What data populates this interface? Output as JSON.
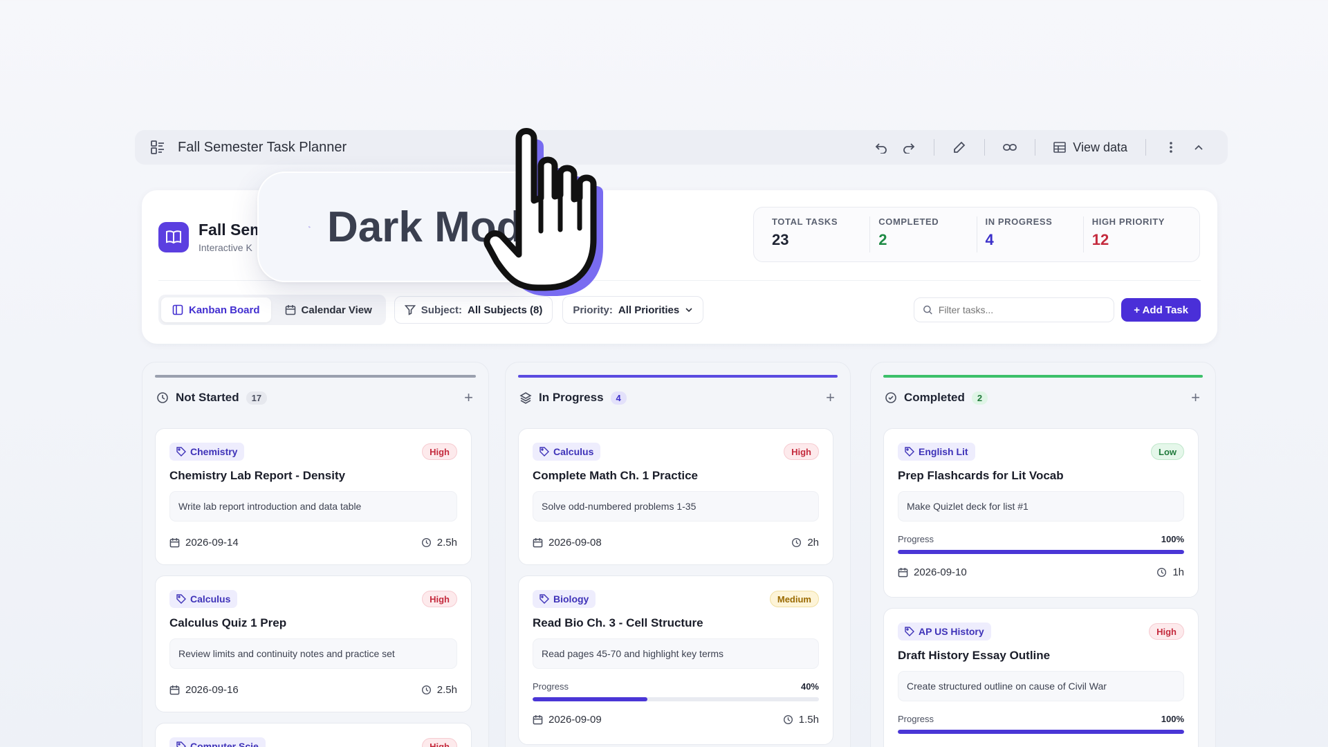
{
  "window": {
    "title": "Fall Semester Task Planner",
    "view_data_label": "View data",
    "icons": [
      "dashboard-icon",
      "undo-icon",
      "redo-icon",
      "pencil-icon",
      "link-icon",
      "table-icon",
      "more-vertical-icon",
      "chevron-up-icon"
    ]
  },
  "header": {
    "title": "Fall Sem",
    "subtitle": "Interactive K",
    "stats": [
      {
        "label": "TOTAL TASKS",
        "value": "23",
        "color": "#1f2433"
      },
      {
        "label": "COMPLETED",
        "value": "2",
        "color": "#1e8a45"
      },
      {
        "label": "IN PROGRESS",
        "value": "4",
        "color": "#3b2fc9"
      },
      {
        "label": "HIGH PRIORITY",
        "value": "12",
        "color": "#c42a3d"
      }
    ]
  },
  "toolbar": {
    "kanban_label": "Kanban Board",
    "calendar_label": "Calendar View",
    "subject_label": "Subject:",
    "subject_value": "All Subjects (8)",
    "priority_label": "Priority:",
    "priority_value": "All Priorities",
    "search_placeholder": "Filter tasks...",
    "add_label": "+ Add Task"
  },
  "overlay": {
    "text": "Dark Mode"
  },
  "columns": [
    {
      "title": "Not Started",
      "count": "17",
      "accent": "#9aa0ae",
      "count_bg": "#e6e8ee",
      "count_color": "#4a4f5f",
      "cards": [
        {
          "tag": "Chemistry",
          "priority": "High",
          "title": "Chemistry Lab Report - Density",
          "desc": "Write lab report introduction and data table",
          "date": "2026-09-14",
          "hours": "2.5h"
        },
        {
          "tag": "Calculus",
          "priority": "High",
          "title": "Calculus Quiz 1 Prep",
          "desc": "Review limits and continuity notes and practice set",
          "date": "2026-09-16",
          "hours": "2.5h"
        },
        {
          "tag": "Computer Scie",
          "priority": "High"
        }
      ]
    },
    {
      "title": "In Progress",
      "count": "4",
      "accent": "#5b4be0",
      "count_bg": "#e3e1fb",
      "count_color": "#3b2fc9",
      "cards": [
        {
          "tag": "Calculus",
          "priority": "High",
          "title": "Complete Math Ch. 1 Practice",
          "desc": "Solve odd-numbered problems 1-35",
          "date": "2026-09-08",
          "hours": "2h"
        },
        {
          "tag": "Biology",
          "priority": "Medium",
          "title": "Read Bio Ch. 3 - Cell Structure",
          "desc": "Read pages 45-70 and highlight key terms",
          "progress_label": "Progress",
          "progress_text": "40%",
          "progress": 0.4,
          "date": "2026-09-09",
          "hours": "1.5h"
        }
      ]
    },
    {
      "title": "Completed",
      "count": "2",
      "accent": "#3cc06a",
      "count_bg": "#dff5e6",
      "count_color": "#217a3c",
      "cards": [
        {
          "tag": "English Lit",
          "priority": "Low",
          "title": "Prep Flashcards for Lit Vocab",
          "desc": "Make Quizlet deck for list #1",
          "progress_label": "Progress",
          "progress_text": "100%",
          "progress": 1.0,
          "date": "2026-09-10",
          "hours": "1h"
        },
        {
          "tag": "AP US History",
          "priority": "High",
          "title": "Draft History Essay Outline",
          "desc": "Create structured outline on cause of Civil War",
          "progress_label": "Progress",
          "progress_text": "100%",
          "progress": 1.0
        }
      ]
    }
  ]
}
